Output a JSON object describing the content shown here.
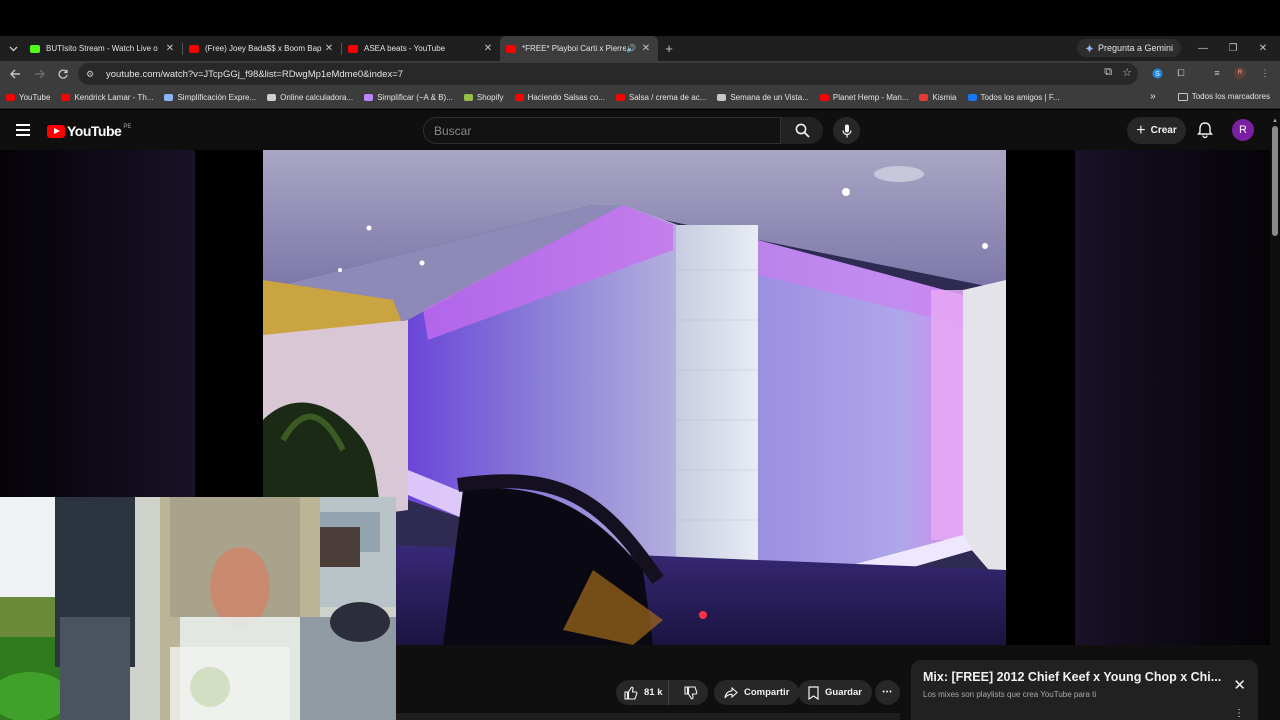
{
  "browser": {
    "tabs": [
      {
        "title": "BUTIsito Stream - Watch Live o",
        "favicon_color": "#53fc18",
        "active": false
      },
      {
        "title": "(Free) Joey Bada$$ x Boom Bap",
        "favicon_color": "#ff0000",
        "active": false
      },
      {
        "title": "ASEA beats - YouTube",
        "favicon_color": "#ff0000",
        "active": false
      },
      {
        "title": "*FREE* Playboi Carti x Pierre",
        "favicon_color": "#ff0000",
        "active": true
      }
    ],
    "new_tab_label": "+",
    "gemini_label": "Pregunta a Gemini",
    "url": "youtube.com/watch?v=JTcpGGj_f98&list=RDwgMp1eMdme0&index=7",
    "profile_initial": "R"
  },
  "bookmarks": {
    "items": [
      {
        "label": "YouTube",
        "color": "#ff0000"
      },
      {
        "label": "Kendrick Lamar - Th...",
        "color": "#ff0000"
      },
      {
        "label": "Simplificación Expre...",
        "color": "#8ab4f8"
      },
      {
        "label": "Online calculadora...",
        "color": "#cfcfcf"
      },
      {
        "label": "Simplificar (−A & B)...",
        "color": "#bb86fc"
      },
      {
        "label": "Shopify",
        "color": "#95bf47"
      },
      {
        "label": "Haciendo Salsas co...",
        "color": "#ff0000"
      },
      {
        "label": "Salsa / crema de ac...",
        "color": "#ff0000"
      },
      {
        "label": "Semana de un Vista...",
        "color": "#c4c7c5"
      },
      {
        "label": "Planet Hemp - Man...",
        "color": "#ff0000"
      },
      {
        "label": "Kismia",
        "color": "#e53935"
      },
      {
        "label": "Todos los amigos | F...",
        "color": "#1877f2"
      }
    ],
    "overflow": "»",
    "all_label": "Todos los marcadores"
  },
  "youtube": {
    "logo_text": "YouTube",
    "country_code": "PE",
    "search_placeholder": "Buscar",
    "create_label": "Crear",
    "avatar_initial": "R",
    "like_count": "81 k",
    "share_label": "Compartir",
    "save_label": "Guardar",
    "more_label": "•••"
  },
  "mix_panel": {
    "title": "Mix: [FREE] 2012 Chief Keef x Young Chop x Chi...",
    "subtitle": "Los mixes son playlists que crea YouTube para ti",
    "close_label": "✕",
    "menu_label": "⋮"
  }
}
